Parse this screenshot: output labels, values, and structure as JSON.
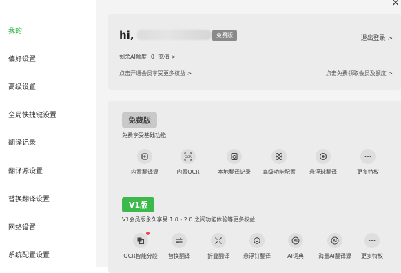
{
  "sidebar": {
    "items": [
      {
        "label": "我的"
      },
      {
        "label": "偏好设置"
      },
      {
        "label": "高级设置"
      },
      {
        "label": "全局快捷键设置"
      },
      {
        "label": "翻译记录"
      },
      {
        "label": "翻译源设置"
      },
      {
        "label": "替换翻译设置"
      },
      {
        "label": "网络设置"
      },
      {
        "label": "系统配置设置"
      }
    ],
    "active_color": "#2fb24c"
  },
  "account": {
    "greeting": "hi,",
    "plan_badge": "免费版",
    "logout": "退出登录 >",
    "quota_label": "剩余AI额度",
    "quota_value": "0",
    "recharge": "充值 >",
    "upgrade_link": "点击开通会员享受更多权益 >",
    "free_link": "点击免费领取会员及额度 >"
  },
  "free_tier": {
    "title": "免费版",
    "desc": "免费享受基础功能",
    "features": [
      {
        "label": "内置翻译源",
        "icon": "translate-source-icon"
      },
      {
        "label": "内置OCR",
        "icon": "ocr-icon"
      },
      {
        "label": "本地翻译记录",
        "icon": "local-history-icon"
      },
      {
        "label": "高级功能配置",
        "icon": "advanced-config-icon"
      },
      {
        "label": "悬浮球翻译",
        "icon": "floating-ball-icon"
      },
      {
        "label": "更多特权",
        "icon": "more-icon"
      }
    ]
  },
  "v1_tier": {
    "title": "V1版",
    "desc": "V1会员版永久享受 1.0 - 2.0 之间功能体验等更多权益",
    "accent": "#3cb94b",
    "features": [
      {
        "label": "OCR智能分段",
        "icon": "ocr-segment-icon"
      },
      {
        "label": "替换翻译",
        "icon": "replace-translate-icon"
      },
      {
        "label": "折叠翻译",
        "icon": "fold-translate-icon"
      },
      {
        "label": "悬浮钉翻译",
        "icon": "pin-translate-icon"
      },
      {
        "label": "AI词典",
        "icon": "ai-dictionary-icon"
      },
      {
        "label": "海量AI翻译源",
        "icon": "ai-sources-icon"
      },
      {
        "label": "更多特权",
        "icon": "more-icon"
      }
    ]
  }
}
